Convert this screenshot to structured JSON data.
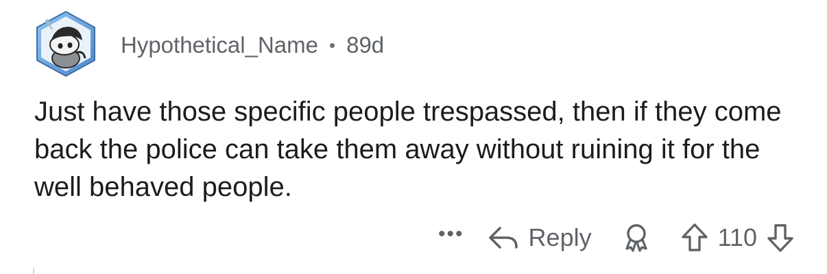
{
  "comment": {
    "username": "Hypothetical_Name",
    "separator": "•",
    "age": "89d",
    "text": "Just have those specific people trespassed, then if they come back the police can take them away without ruining it for the well behaved people."
  },
  "actions": {
    "more_label": "•••",
    "reply_label": "Reply",
    "vote_count": "110"
  },
  "icons": {
    "avatar": "snoo-avatar",
    "more": "more-options-icon",
    "reply": "reply-arrow-icon",
    "award": "award-icon",
    "upvote": "upvote-arrow-icon",
    "downvote": "downvote-arrow-icon"
  },
  "colors": {
    "meta_text": "#5f6368",
    "body_text": "#1c1c1c",
    "avatar_border": "#5b9bd5"
  }
}
